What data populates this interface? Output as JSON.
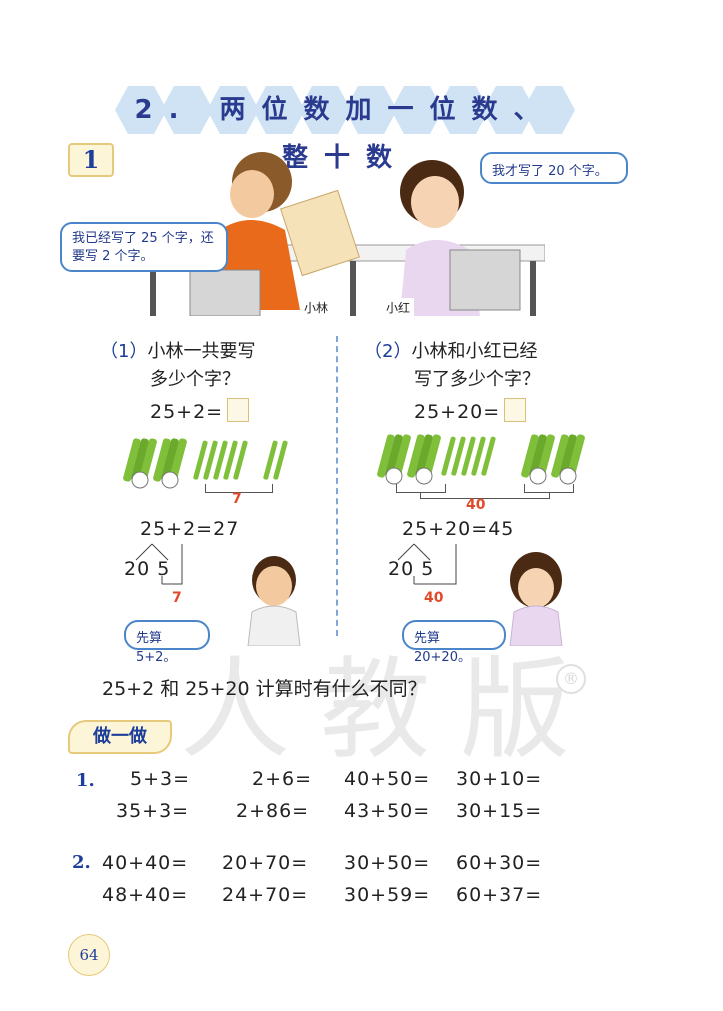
{
  "title": "2. 两位数加一位数、整十数",
  "example_number": "1",
  "scene": {
    "bubble_left": "我已经写了 25 个字，还要写 2 个字。",
    "bubble_right": "我才写了 20 个字。",
    "name_boy": "小林",
    "name_girl": "小红"
  },
  "part1": {
    "num": "（1）",
    "question_line1": "小林一共要写",
    "question_line2": "多少个字？",
    "equation": "25+2=",
    "bracket_label": "7",
    "result": "25+2=27",
    "split": "20 5",
    "split_label": "7",
    "hint": "先算 5+2。"
  },
  "part2": {
    "num": "（2）",
    "question_line1": "小林和小红已经",
    "question_line2": "写了多少个字？",
    "equation": "25+20=",
    "bracket_label": "40",
    "result": "25+20=45",
    "split": "20 5",
    "split_label": "40",
    "hint": "先算 20+20。"
  },
  "compare_question": "25+2 和 25+20 计算时有什么不同？",
  "watermark": "人教版",
  "registered": "®",
  "practice_label": "做一做",
  "exercises": [
    {
      "num": "1.",
      "rows": [
        [
          "5+3=",
          "2+6=",
          "40+50=",
          "30+10="
        ],
        [
          "35+3=",
          "2+86=",
          "43+50=",
          "30+15="
        ]
      ]
    },
    {
      "num": "2.",
      "rows": [
        [
          "40+40=",
          "20+70=",
          "30+50=",
          "60+30="
        ],
        [
          "48+40=",
          "24+70=",
          "30+59=",
          "60+37="
        ]
      ]
    }
  ],
  "page_number": "64",
  "colors": {
    "title_text": "#2a3a8f",
    "hexagon": "#cfe3f5",
    "badge_fill": "#fdf5d8",
    "stick_green": "#7fbf3a",
    "highlight_red": "#e04a2a",
    "divider_blue": "#7fa6d6"
  }
}
